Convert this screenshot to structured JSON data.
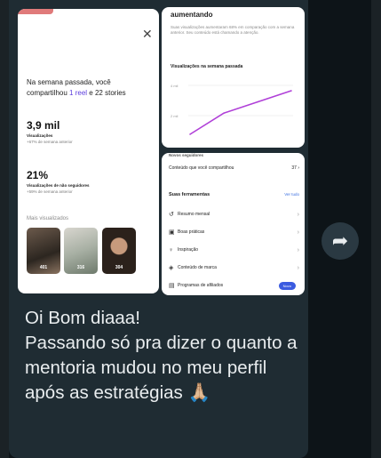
{
  "left_screen": {
    "week_prefix": "Na semana passada, você compartilhou",
    "week_reel": "1 reel",
    "week_mid": "e",
    "week_stories": "22 stories",
    "views_value": "3,9 mil",
    "views_label": "Visualizações",
    "views_change": "+67% de semana anterior",
    "nonfollowers_value": "21%",
    "nonfollowers_label": "Visualizações de não seguidores",
    "nonfollowers_change": "+59% de semana anterior",
    "most_viewed_label": "Mais visualizados",
    "thumbnails": [
      {
        "count": "401"
      },
      {
        "count": "316"
      },
      {
        "count": "304"
      }
    ]
  },
  "right_top_screen": {
    "title": "aumentando",
    "description": "Suas visualizações aumentaram 68% em comparação com a semana anterior. Seu conteúdo está chamando a atenção.",
    "chart_label": "Visualizações na semana passada",
    "y_ticks": [
      "4 mil",
      "2 mil"
    ],
    "chart_data": {
      "type": "line",
      "series": [
        {
          "name": "",
          "values": [
            0.5,
            2.2,
            3.1,
            4.0
          ]
        }
      ],
      "ylim": [
        0,
        5
      ]
    }
  },
  "right_bottom_screen": {
    "header": "Novos seguidores",
    "shared_label": "Conteúdo que você compartilhou",
    "shared_value": "37",
    "tools_title": "Suas ferramentas",
    "see_all": "Ver tudo",
    "tools": [
      {
        "icon": "clock-icon",
        "label": "Resumo mensal"
      },
      {
        "icon": "tips-icon",
        "label": "Boas práticas"
      },
      {
        "icon": "bulb-icon",
        "label": "Inspiração"
      },
      {
        "icon": "tag-icon",
        "label": "Conteúdo de marca"
      },
      {
        "icon": "affiliate-icon",
        "label": "Programas de afiliados",
        "badge": "Novo"
      }
    ]
  },
  "message": {
    "text": "Oi Bom diaaa!\nPassando só pra dizer o quanto a mentoria mudou no meu perfil após as estratégias 🙏🏼"
  },
  "colors": {
    "chat_bg": "#0d1418",
    "bubble": "#1f2c33",
    "accent_purple": "#b040d8"
  }
}
